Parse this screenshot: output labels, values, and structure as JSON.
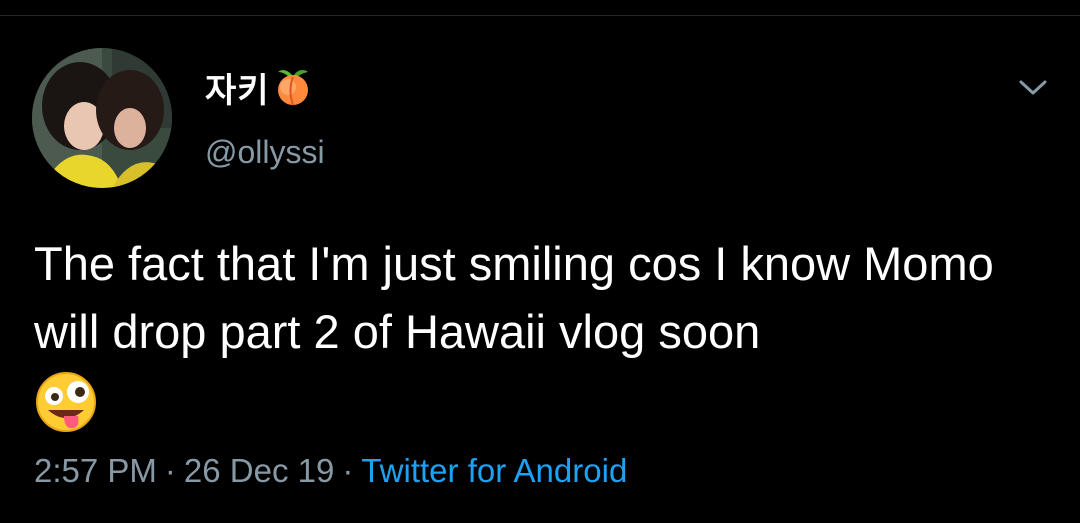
{
  "tweet": {
    "display_name": "자키",
    "name_emoji": "peach-icon",
    "handle": "@ollyssi",
    "text": "The fact that I'm just smiling cos I know Momo will drop part 2 of Hawaii vlog soon",
    "text_emoji": "zany-face-icon",
    "time": "2:57 PM",
    "date": "26 Dec 19",
    "source": "Twitter for Android",
    "separator": "·"
  },
  "colors": {
    "background": "#000000",
    "text": "#ffffff",
    "secondary_text": "#8899a6",
    "link": "#1da1f2"
  }
}
